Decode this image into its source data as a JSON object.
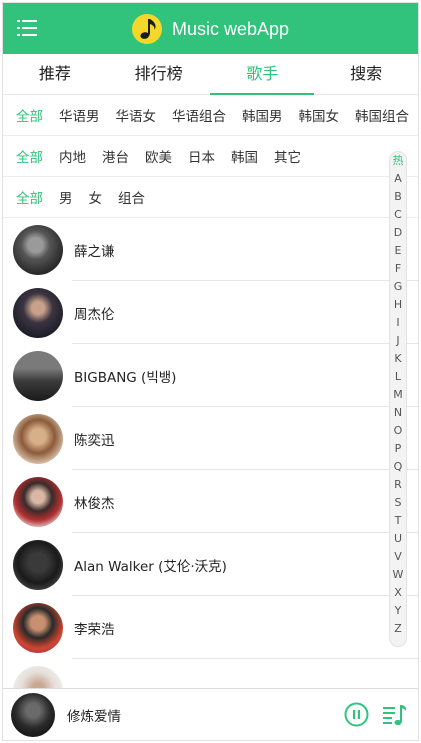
{
  "header": {
    "title": "Music webApp",
    "menu_icon": "menu-icon",
    "logo_icon": "music-note-logo",
    "color": "#31c27c"
  },
  "tabs": [
    {
      "label": "推荐"
    },
    {
      "label": "排行榜"
    },
    {
      "label": "歌手"
    },
    {
      "label": "搜索"
    }
  ],
  "active_tab": "歌手",
  "accent_color": "#31c27c",
  "filters": {
    "category": [
      "全部",
      "华语男",
      "华语女",
      "华语组合",
      "韩国男",
      "韩国女",
      "韩国组合"
    ],
    "region": [
      "全部",
      "内地",
      "港台",
      "欧美",
      "日本",
      "韩国",
      "其它"
    ],
    "type": [
      "全部",
      "男",
      "女",
      "组合"
    ],
    "selected": "全部"
  },
  "singers": [
    {
      "name": "薛之谦"
    },
    {
      "name": "周杰伦"
    },
    {
      "name": "BIGBANG (빅뱅)"
    },
    {
      "name": "陈奕迅"
    },
    {
      "name": "林俊杰"
    },
    {
      "name": "Alan Walker (艾伦·沃克)"
    },
    {
      "name": "李荣浩"
    },
    {
      "name": ""
    }
  ],
  "alphabet": [
    "热",
    "A",
    "B",
    "C",
    "D",
    "E",
    "F",
    "G",
    "H",
    "I",
    "J",
    "K",
    "L",
    "M",
    "N",
    "O",
    "P",
    "Q",
    "R",
    "S",
    "T",
    "U",
    "V",
    "W",
    "X",
    "Y",
    "Z"
  ],
  "player": {
    "song": "修炼爱情",
    "play_icon": "pause-icon",
    "list_icon": "playlist-icon"
  }
}
